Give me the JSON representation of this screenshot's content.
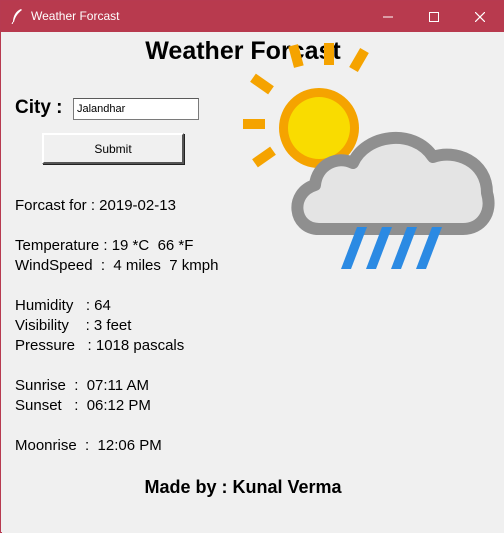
{
  "window": {
    "title": "Weather Forcast",
    "icon": "feather-icon",
    "controls": [
      "minimize-icon",
      "maximize-icon",
      "close-icon"
    ]
  },
  "heading": "Weather Forcast",
  "city": {
    "label": "City :",
    "value": "Jalandhar",
    "submit_label": "Submit"
  },
  "forecast": {
    "date_line": "Forcast for : 2019-02-13",
    "temperature_line": "Temperature : 19 *C  66 *F",
    "windspeed_line": "WindSpeed  :  4 miles  7 kmph",
    "humidity_line": "Humidity   : 64",
    "visibility_line": "Visibility    : 3 feet",
    "pressure_line": "Pressure   : 1018 pascals",
    "sunrise_line": "Sunrise  :  07:11 AM",
    "sunset_line": "Sunset   :  06:12 PM",
    "moonrise_line": "Moonrise  :  12:06 PM"
  },
  "weather_image": "partly-cloudy-rain-icon",
  "footer": "Made by : Kunal Verma",
  "colors": {
    "titlebar": "#b83a4e",
    "background": "#f0f0f0",
    "sun": "#f9c300",
    "sun_rays": "#f5a300",
    "cloud_outline": "#8f8f8f",
    "cloud_fill": "#e4e4e4",
    "rain": "#2b8ae3"
  }
}
